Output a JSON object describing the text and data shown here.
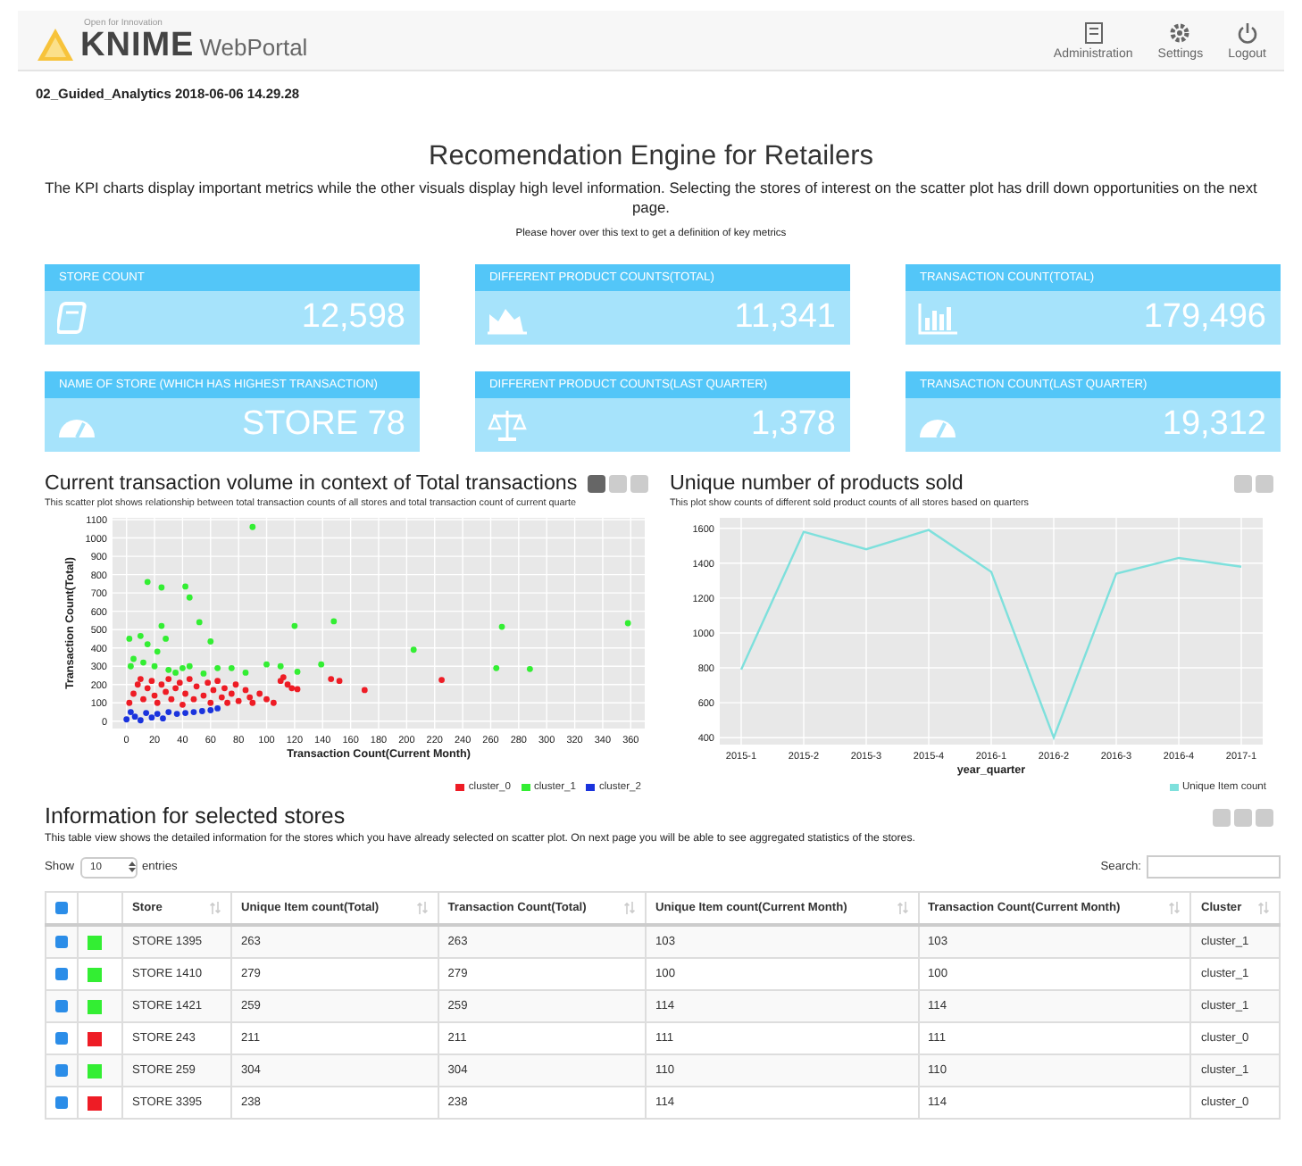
{
  "header": {
    "tagline": "Open for Innovation",
    "brand": "KNIME",
    "product": "WebPortal",
    "nav": [
      {
        "label": "Administration"
      },
      {
        "label": "Settings"
      },
      {
        "label": "Logout"
      }
    ]
  },
  "breadcrumb": "02_Guided_Analytics 2018-06-06 14.29.28",
  "title": "Recomendation Engine for Retailers",
  "description": "The KPI charts display important metrics while the other visuals display high level information. Selecting the stores of interest on the scatter plot has drill down opportunities on the next page.",
  "hint": "Please hover over this text to get a definition of key metrics",
  "kpis": [
    {
      "label": "STORE COUNT",
      "value": "12,598"
    },
    {
      "label": "DIFFERENT PRODUCT COUNTS(TOTAL)",
      "value": "11,341"
    },
    {
      "label": "TRANSACTION COUNT(TOTAL)",
      "value": "179,496"
    },
    {
      "label": "NAME OF STORE (WHICH HAS HIGHEST TRANSACTION)",
      "value": "STORE 78"
    },
    {
      "label": "DIFFERENT PRODUCT COUNTS(LAST QUARTER)",
      "value": "1,378"
    },
    {
      "label": "TRANSACTION COUNT(LAST QUARTER)",
      "value": "19,312"
    }
  ],
  "scatter": {
    "title": "Current transaction volume in context of Total transactions",
    "subtitle": "This scatter plot shows relationship between total transaction counts of all stores and total transaction count of current quarte",
    "chart_data": {
      "type": "scatter",
      "xlabel": "Transaction Count(Current Month)",
      "ylabel": "Transaction Count(Total)",
      "grid": true,
      "xlim": [
        -10,
        370
      ],
      "ylim": [
        -40,
        1110
      ],
      "xticks": [
        0,
        20,
        40,
        60,
        80,
        100,
        120,
        140,
        160,
        180,
        200,
        220,
        240,
        260,
        280,
        300,
        320,
        340,
        360
      ],
      "yticks": [
        0,
        100,
        200,
        300,
        400,
        500,
        600,
        700,
        800,
        900,
        1000,
        1100
      ],
      "series": [
        {
          "name": "cluster_0",
          "color": "#ee1c25",
          "x": [
            2,
            5,
            8,
            10,
            12,
            15,
            18,
            20,
            22,
            25,
            28,
            30,
            32,
            35,
            38,
            40,
            42,
            45,
            48,
            50,
            55,
            58,
            60,
            62,
            65,
            68,
            70,
            72,
            75,
            78,
            80,
            85,
            88,
            90,
            95,
            100,
            105,
            110,
            112,
            115,
            118,
            122,
            146,
            152,
            170,
            225
          ],
          "values": [
            100,
            150,
            200,
            230,
            120,
            180,
            220,
            140,
            100,
            200,
            160,
            230,
            120,
            180,
            210,
            90,
            150,
            230,
            120,
            190,
            140,
            210,
            100,
            170,
            220,
            130,
            180,
            100,
            150,
            200,
            110,
            170,
            130,
            100,
            150,
            120,
            100,
            220,
            240,
            200,
            180,
            175,
            230,
            220,
            170,
            225
          ]
        },
        {
          "name": "cluster_1",
          "color": "#33ee33",
          "x": [
            90,
            15,
            25,
            42,
            45,
            25,
            52,
            60,
            120,
            148,
            205,
            268,
            358,
            264,
            288,
            139,
            2,
            10,
            15,
            22,
            28,
            5,
            12,
            3,
            20,
            30,
            40,
            45,
            55,
            65,
            75,
            85,
            100,
            110,
            122,
            35
          ],
          "values": [
            1060,
            760,
            730,
            735,
            675,
            520,
            540,
            435,
            520,
            545,
            390,
            515,
            535,
            290,
            285,
            310,
            450,
            465,
            420,
            380,
            450,
            340,
            320,
            300,
            300,
            280,
            290,
            300,
            260,
            290,
            290,
            265,
            310,
            300,
            270,
            265
          ]
        },
        {
          "name": "cluster_2",
          "color": "#1a33dd",
          "x": [
            0,
            3,
            6,
            10,
            14,
            18,
            22,
            26,
            30,
            36,
            42,
            48,
            54,
            60,
            65
          ],
          "values": [
            10,
            50,
            25,
            5,
            45,
            20,
            40,
            15,
            50,
            40,
            45,
            50,
            55,
            60,
            70
          ]
        }
      ]
    }
  },
  "line": {
    "title": "Unique number of products sold",
    "subtitle": "This plot show counts of different sold product counts of all stores based on quarters",
    "chart_data": {
      "type": "line",
      "grid": true,
      "xlabel": "year_quarter",
      "ylim": [
        360,
        1660
      ],
      "yticks": [
        400,
        600,
        800,
        1000,
        1200,
        1400,
        1600
      ],
      "categories": [
        "2015-1",
        "2015-2",
        "2015-3",
        "2015-4",
        "2016-1",
        "2016-2",
        "2016-3",
        "2016-4",
        "2017-1"
      ],
      "series": [
        {
          "name": "Unique Item count",
          "color": "#7ee0dc",
          "values": [
            790,
            1580,
            1480,
            1590,
            1350,
            400,
            1340,
            1430,
            1380
          ]
        }
      ]
    }
  },
  "table": {
    "title": "Information for selected stores",
    "subtitle": "This table view shows the detailed information for the stores which you have already selected on scatter plot. On next page you will be able to see aggregated statistics of the stores.",
    "show_label": "Show",
    "page_size": "10",
    "entries_label": "entries",
    "search_label": "Search:",
    "all_checked": true,
    "columns": [
      "Store",
      "Unique Item count(Total)",
      "Transaction Count(Total)",
      "Unique Item count(Current Month)",
      "Transaction Count(Current Month)",
      "Cluster"
    ],
    "rows": [
      {
        "checked": true,
        "color": "#33ee33",
        "cells": [
          "STORE 1395",
          "263",
          "263",
          "103",
          "103",
          "cluster_1"
        ]
      },
      {
        "checked": true,
        "color": "#33ee33",
        "cells": [
          "STORE 1410",
          "279",
          "279",
          "100",
          "100",
          "cluster_1"
        ]
      },
      {
        "checked": true,
        "color": "#33ee33",
        "cells": [
          "STORE 1421",
          "259",
          "259",
          "114",
          "114",
          "cluster_1"
        ]
      },
      {
        "checked": true,
        "color": "#ee1c25",
        "cells": [
          "STORE 243",
          "211",
          "211",
          "111",
          "111",
          "cluster_0"
        ]
      },
      {
        "checked": true,
        "color": "#33ee33",
        "cells": [
          "STORE 259",
          "304",
          "304",
          "110",
          "110",
          "cluster_1"
        ]
      },
      {
        "checked": true,
        "color": "#ee1c25",
        "cells": [
          "STORE 3395",
          "238",
          "238",
          "114",
          "114",
          "cluster_0"
        ]
      }
    ]
  }
}
